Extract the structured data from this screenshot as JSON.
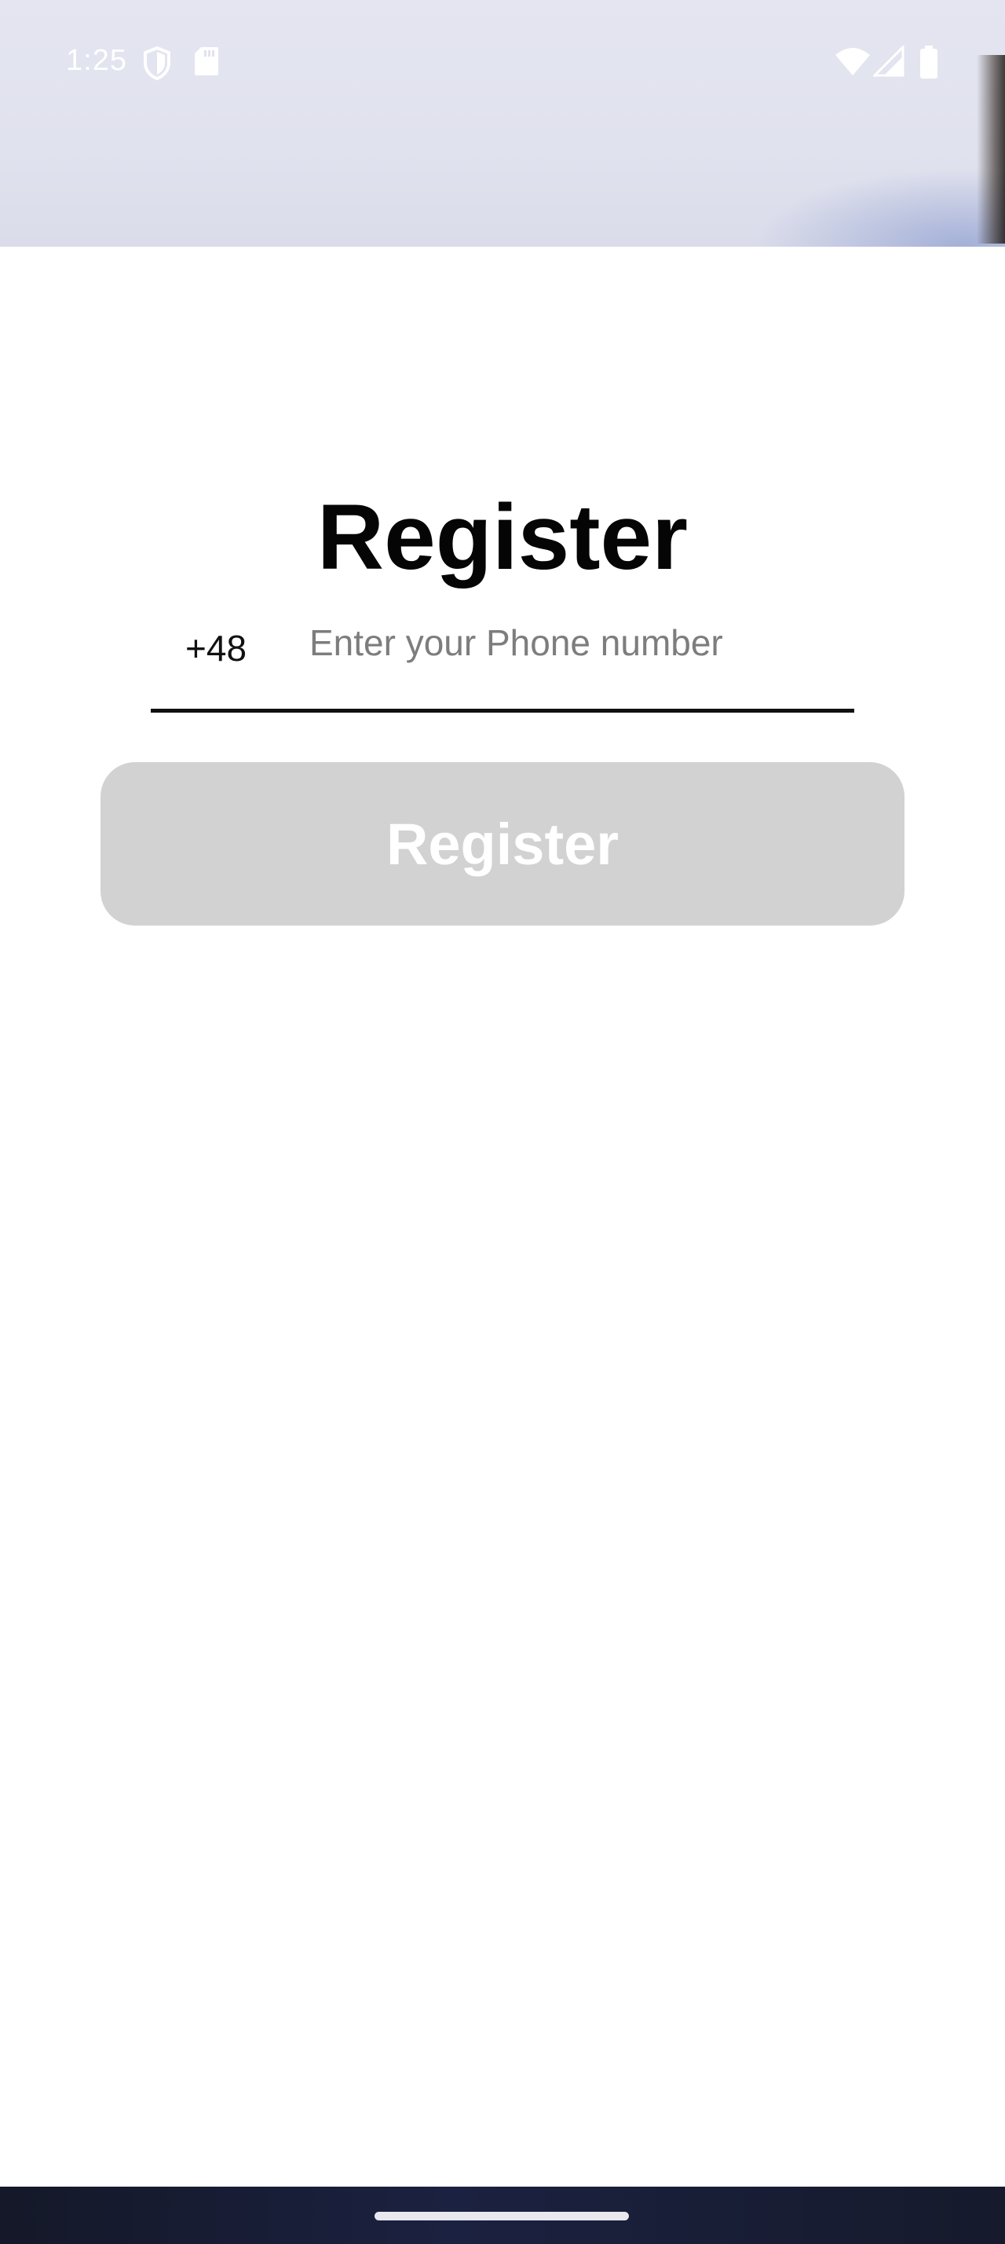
{
  "status_bar": {
    "time": "1:25",
    "icons": [
      "shield-icon",
      "sd-card-icon",
      "wifi-icon",
      "signal-icon",
      "battery-icon"
    ]
  },
  "register_form": {
    "title": "Register",
    "country_code": "+48",
    "phone_input": {
      "placeholder": "Enter your Phone number",
      "value": ""
    },
    "submit_label": "Register",
    "submit_state": "disabled"
  },
  "colors": {
    "header_background": "#e2e3ef",
    "button_disabled": "#d2d2d2",
    "button_text": "#ffffff",
    "title_text": "#050505",
    "underline": "#111111",
    "nav_bar": "#161a2c"
  }
}
